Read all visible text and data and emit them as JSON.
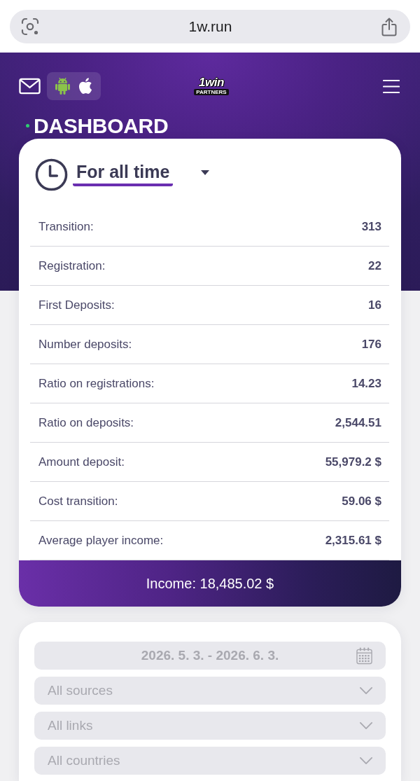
{
  "browser_bar": {
    "url": "1w.run"
  },
  "header": {
    "logo": {
      "wordmark": "1win",
      "tagline": "PARTNERS"
    },
    "title": "DASHBOARD"
  },
  "stats": {
    "period": "For all time",
    "rows": [
      {
        "label": "Transition:",
        "value": "313"
      },
      {
        "label": "Registration:",
        "value": "22"
      },
      {
        "label": "First Deposits:",
        "value": "16"
      },
      {
        "label": "Number deposits:",
        "value": "176"
      },
      {
        "label": "Ratio on registrations:",
        "value": "14.23"
      },
      {
        "label": "Ratio on deposits:",
        "value": "2,544.51"
      },
      {
        "label": "Amount deposit:",
        "value": "55,979.2 $"
      },
      {
        "label": "Cost transition:",
        "value": "59.06 $"
      },
      {
        "label": "Average player income:",
        "value": "2,315.61 $"
      }
    ],
    "income": "Income: 18,485.02 $"
  },
  "filters": [
    {
      "kind": "date",
      "value": "2026. 5. 3. - 2026. 6. 3."
    },
    {
      "kind": "select",
      "placeholder": "All sources"
    },
    {
      "kind": "select",
      "placeholder": "All links"
    },
    {
      "kind": "select",
      "placeholder": "All countries"
    }
  ]
}
